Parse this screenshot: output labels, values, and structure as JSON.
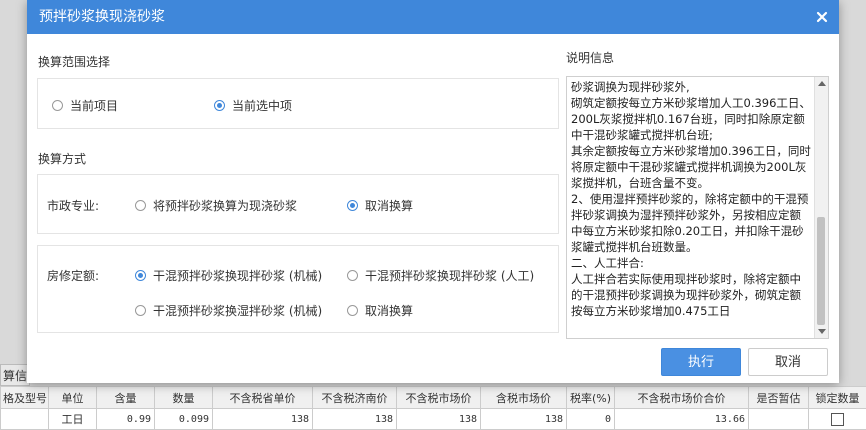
{
  "dialog": {
    "title": "预拌砂浆换现浇砂浆",
    "range_section": "换算范围选择",
    "range_options": [
      "当前项目",
      "当前选中项"
    ],
    "method_section": "换算方式",
    "municipal_label": "市政专业:",
    "municipal_options": [
      "将预拌砂浆换算为现浇砂浆",
      "取消换算"
    ],
    "housing_label": "房修定额:",
    "housing_options": [
      "干混预拌砂浆换现拌砂浆 (机械)",
      "干混预拌砂浆换现拌砂浆 (人工)",
      "干混预拌砂浆换湿拌砂浆 (机械)",
      "取消换算"
    ],
    "info_section": "说明信息",
    "info_text": "砂浆调换为现拌砂浆外,\n砌筑定额按每立方米砂浆增加人工0.396工日、200L灰浆搅拌机0.167台班，同时扣除原定额中干混砂浆罐式搅拌机台班;\n其余定额按每立方米砂浆增加0.396工日，同时将原定额中干混砂浆罐式搅拌机调换为200L灰浆搅拌机，台班含量不变。\n2、使用湿拌预拌砂浆的，除将定额中的干混预拌砂浆调换为湿拌预拌砂浆外，另按相应定额中每立方米砂浆扣除0.20工日，并扣除干混砂浆罐式搅拌机台班数量。\n二、人工拌合:\n人工拌合若实际使用现拌砂浆时，除将定额中的干混预拌砂浆调换为现拌砂浆外，砌筑定额按每立方米砂浆增加0.475工日",
    "execute_label": "执行",
    "cancel_label": "取消"
  },
  "background": {
    "tab_label": "算信",
    "columns": [
      "格及型号",
      "单位",
      "含量",
      "数量",
      "不含税省单价",
      "不含税济南价",
      "不含税市场价",
      "含税市场价",
      "税率(%)",
      "不含税市场价合价",
      "是否暂估",
      "锁定数量"
    ],
    "row": [
      "",
      "工日",
      "0.99",
      "0.099",
      "138",
      "138",
      "138",
      "138",
      "0",
      "13.66",
      "",
      ""
    ]
  },
  "colors": {
    "accent": "#3f87da",
    "primary_button": "#4a90e2"
  }
}
